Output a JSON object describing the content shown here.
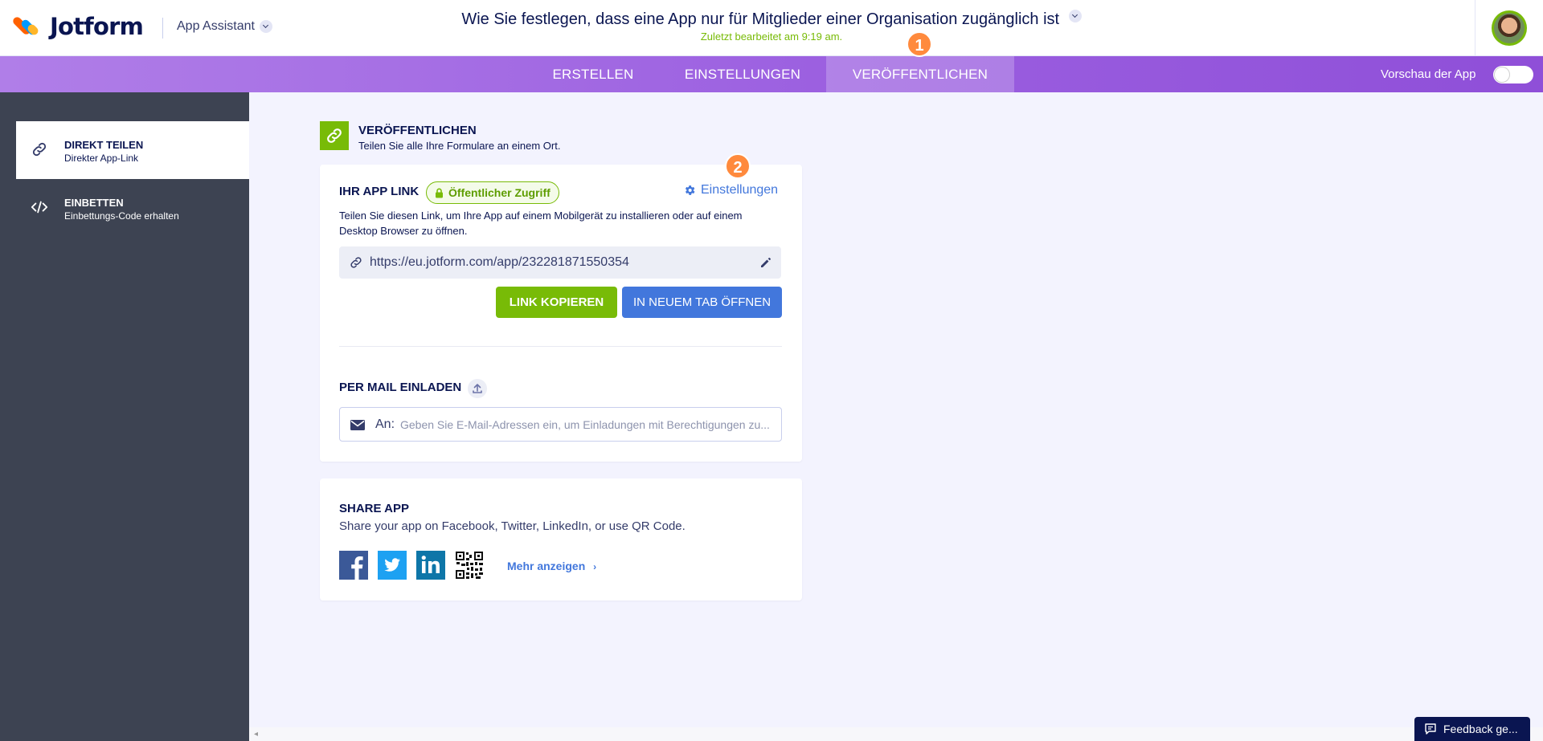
{
  "header": {
    "logo_text": "Jotform",
    "app_assistant_label": "App Assistant",
    "document_title": "Wie Sie festlegen, dass eine App nur für Mitglieder einer Organisation zugänglich ist",
    "last_edited": "Zuletzt bearbeitet am 9:19 am."
  },
  "tabs": [
    {
      "label": "ERSTELLEN",
      "active": false
    },
    {
      "label": "EINSTELLUNGEN",
      "active": false
    },
    {
      "label": "VERÖFFENTLICHEN",
      "active": true
    }
  ],
  "preview_label": "Vorschau der App",
  "annotations": {
    "step1": "1",
    "step2": "2"
  },
  "sidebar": {
    "items": [
      {
        "title": "DIREKT TEILEN",
        "desc": "Direkter App-Link",
        "active": true
      },
      {
        "title": "EINBETTEN",
        "desc": "Einbettungs-Code erhalten",
        "active": false
      }
    ]
  },
  "publish": {
    "title": "VERÖFFENTLICHEN",
    "desc": "Teilen Sie alle Ihre Formulare an einem Ort."
  },
  "app_link": {
    "label": "IHR APP LINK",
    "access_badge": "Öffentlicher Zugriff",
    "settings_link": "Einstellungen",
    "share_text": "Teilen Sie diesen Link, um Ihre App auf einem Mobilgerät zu installieren oder auf einem Desktop Browser zu öffnen.",
    "url": "https://eu.jotform.com/app/232281871550354",
    "copy_button": "LINK KOPIEREN",
    "open_button": "IN NEUEM TAB ÖFFNEN"
  },
  "mail_invite": {
    "label": "PER MAIL EINLADEN",
    "to_label": "An:",
    "placeholder": "Geben Sie E-Mail-Adressen ein, um Einladungen mit Berechtigungen zu..."
  },
  "share_app": {
    "title": "SHARE APP",
    "desc": "Share your app on Facebook, Twitter, LinkedIn, or use QR Code.",
    "more_link": "Mehr anzeigen"
  },
  "feedback_label": "Feedback ge...",
  "colors": {
    "accent_green": "#78bb07",
    "accent_blue": "#4277dc",
    "tab_purple": "#9b5fe0",
    "sidebar_dark": "#3d4352",
    "annotation_orange": "#ff8a3d"
  }
}
